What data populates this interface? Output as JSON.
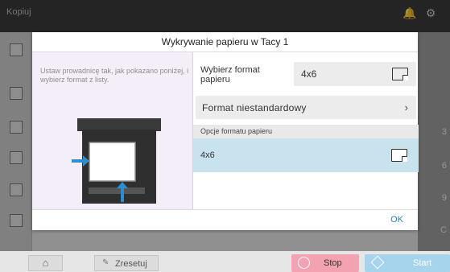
{
  "app": {
    "title": "Kopiuj"
  },
  "right_rail": {
    "numbers": [
      "3",
      "6",
      "9",
      "C"
    ]
  },
  "modal": {
    "title": "Wykrywanie papieru w Tacy 1",
    "instructions": "Ustaw prowadnicę tak, jak pokazano poniżej, i wybierz format z listy.",
    "select_label": "Wybierz format papieru",
    "select_value": "4x6",
    "custom_button": "Format niestandardowy",
    "section_header": "Opcje formatu papieru",
    "options": [
      {
        "label": "4x6",
        "selected": true
      }
    ],
    "ok_label": "OK"
  },
  "bottom": {
    "reset_label": "Zresetuj",
    "stop_label": "Stop",
    "start_label": "Start"
  },
  "colors": {
    "accent_blue": "#2c84b8",
    "selection_bg": "#c9e3ee",
    "stop_pink": "#f3a2b1",
    "start_blue": "#a6d4ec"
  }
}
